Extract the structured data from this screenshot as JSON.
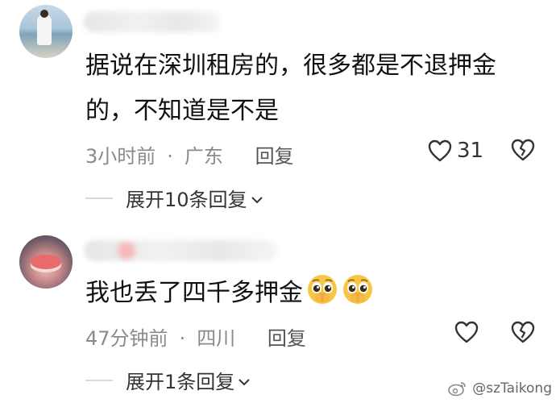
{
  "comments": [
    {
      "text_line1": "据说在深圳租房的，很多都是不退押金",
      "text_line2": "的，不知道是不是",
      "time": "3小时前",
      "dot": "·",
      "location": "广东",
      "reply_label": "回复",
      "like_count": "31",
      "expand_label": "展开10条回复"
    },
    {
      "text_line1": "我也丢了四千多押金",
      "time": "47分钟前",
      "dot": "·",
      "location": "四川",
      "reply_label": "回复",
      "like_count": "",
      "expand_label": "展开1条回复"
    }
  ],
  "watermark": {
    "text": "@szTaikong"
  },
  "icons": {
    "like": "heart-outline-icon",
    "dislike": "broken-heart-icon",
    "expand": "chevron-down-icon",
    "emoji": "pleading-face-emoji-icon"
  },
  "colors": {
    "meta_gray": "#8a8a8a",
    "divider": "#d9d9d9",
    "emoji_yellow": "#f7c744"
  }
}
